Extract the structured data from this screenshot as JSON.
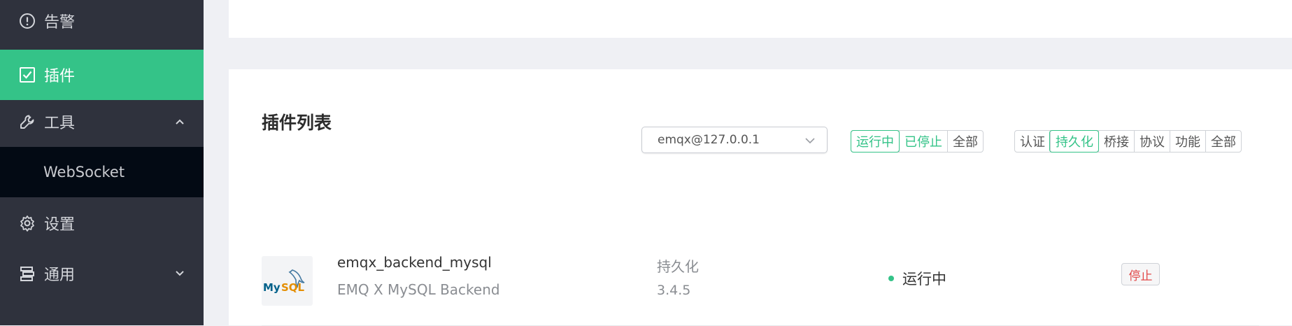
{
  "sidebar": {
    "items": [
      {
        "label": "告警",
        "icon": "alert-circle-icon"
      },
      {
        "label": "插件",
        "icon": "check-square-icon",
        "active": true
      },
      {
        "label": "工具",
        "icon": "wrench-icon",
        "expanded": true
      },
      {
        "label": "WebSocket"
      },
      {
        "label": "设置",
        "icon": "gear-icon"
      },
      {
        "label": "通用",
        "icon": "layers-icon"
      }
    ]
  },
  "plugins": {
    "title": "插件列表",
    "node_select": {
      "value": "emqx@127.0.0.1"
    },
    "status_filter": [
      "运行中",
      "已停止",
      "全部"
    ],
    "type_filter": [
      "认证",
      "持久化",
      "桥接",
      "协议",
      "功能",
      "全部"
    ],
    "rows": [
      {
        "name": "emqx_backend_mysql",
        "description": "EMQ X MySQL Backend",
        "type": "持久化",
        "version": "3.4.5",
        "status": "运行中",
        "action": "停止",
        "logo_text": "MySQL"
      }
    ]
  },
  "colors": {
    "sidebar_bg": "#2f323d",
    "accent": "#34c388",
    "submenu_bg": "#030a14",
    "stop": "#e24a4a"
  }
}
